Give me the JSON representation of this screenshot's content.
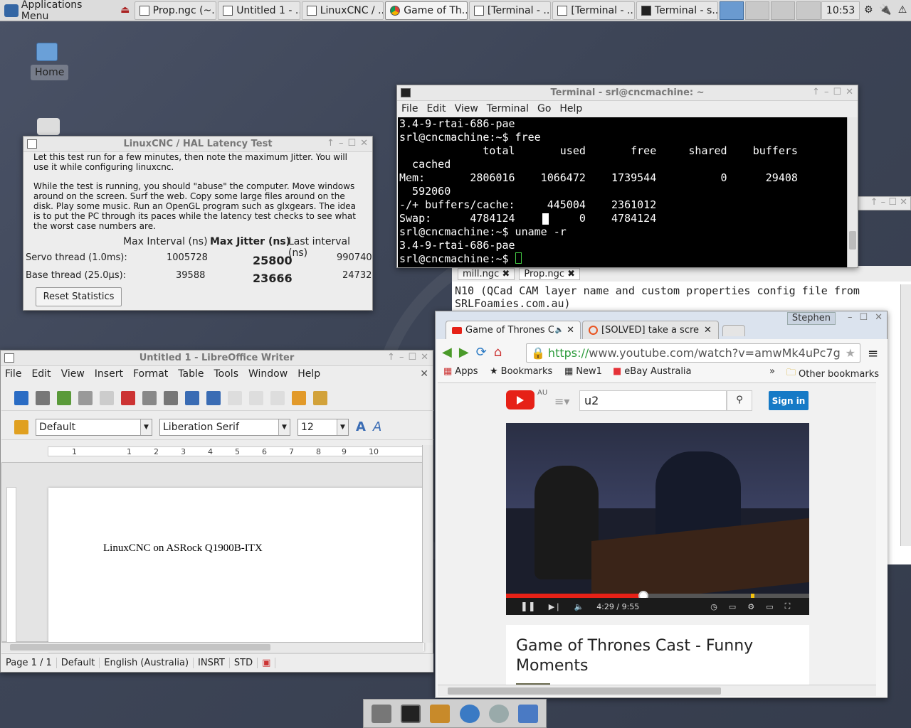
{
  "panel": {
    "app_menu": "Applications Menu",
    "tasks": [
      "Prop.ngc (~...",
      "Untitled 1 - ...",
      "LinuxCNC / ...",
      "Game of Th...",
      "[Terminal - ...",
      "[Terminal - ...",
      "Terminal - s..."
    ],
    "clock": "10:53"
  },
  "desktop": {
    "home_label": "Home"
  },
  "latency": {
    "title": "LinuxCNC / HAL Latency Test",
    "para1": "Let this test run for a few minutes, then note the maximum Jitter.  You will use it while configuring linuxcnc.",
    "para2": "While the test is running, you should \"abuse\" the computer. Move windows around on the screen. Surf the web. Copy some large files around on the disk. Play some music. Run an OpenGL program such as glxgears. The idea is to put the PC through its paces while the latency test checks to see what the worst case numbers are.",
    "col_max_interval": "Max Interval (ns)",
    "col_max_jitter": "Max Jitter (ns)",
    "col_last_interval": "Last interval (ns)",
    "servo_label": "Servo thread (1.0ms):",
    "servo_max_interval": "1005728",
    "servo_max_jitter": "25800",
    "servo_last_interval": "990740",
    "base_label": "Base thread (25.0µs):",
    "base_max_interval": "39588",
    "base_max_jitter": "23666",
    "base_last_interval": "24732",
    "reset_button": "Reset Statistics"
  },
  "terminal": {
    "title": "Terminal - srl@cncmachine: ~",
    "menus": [
      "File",
      "Edit",
      "View",
      "Terminal",
      "Go",
      "Help"
    ],
    "lines": [
      "3.4-9-rtai-686-pae",
      "srl@cncmachine:~$ free",
      "             total       used       free     shared    buffers",
      "  cached",
      "Mem:       2806016    1066472    1739544          0      29408",
      "  592060",
      "-/+ buffers/cache:     445004    2361012",
      "Swap:      4784124          0    4784124",
      "srl@cncmachine:~$ uname -r",
      "3.4-9-rtai-686-pae",
      "srl@cncmachine:~$ "
    ]
  },
  "editor_bg": {
    "tabs": [
      "mill.ngc",
      "Prop.ngc"
    ],
    "line1": "N10 (QCad CAM layer name and custom properties config file from",
    "line2": "SRLFoamies.com.au)"
  },
  "writer": {
    "title": "Untitled 1 - LibreOffice Writer",
    "menus": [
      "File",
      "Edit",
      "View",
      "Insert",
      "Format",
      "Table",
      "Tools",
      "Window",
      "Help"
    ],
    "style": "Default",
    "font": "Liberation Serif",
    "size": "12",
    "doc_text": "LinuxCNC on ASRock Q1900B-ITX",
    "ruler_marks": [
      "1",
      "1",
      "2",
      "3",
      "4",
      "5",
      "6",
      "7",
      "8",
      "9",
      "10",
      "11"
    ],
    "status": [
      "Page 1 / 1",
      "Default",
      "English (Australia)",
      "INSRT",
      "STD"
    ]
  },
  "chrome": {
    "user": "Stephen",
    "tab1": "Game of Thrones C",
    "tab2": "[SOLVED] take a scre",
    "url_https": "https://",
    "url_rest": "www.youtube.com/watch?v=amwMk4uPc7g",
    "bookmarks": [
      "Apps",
      "Bookmarks",
      "New1",
      "eBay Australia"
    ],
    "other_bookmarks": "Other bookmarks",
    "yt_region": "AU",
    "search_value": "u2",
    "sign_in": "Sign in",
    "time": "4:29 / 9:55",
    "progress": 0.452,
    "video_title": "Game of Thrones Cast - Funny Moments",
    "colors": {
      "yt_red": "#e62117",
      "signin_blue": "#167ac6"
    }
  }
}
